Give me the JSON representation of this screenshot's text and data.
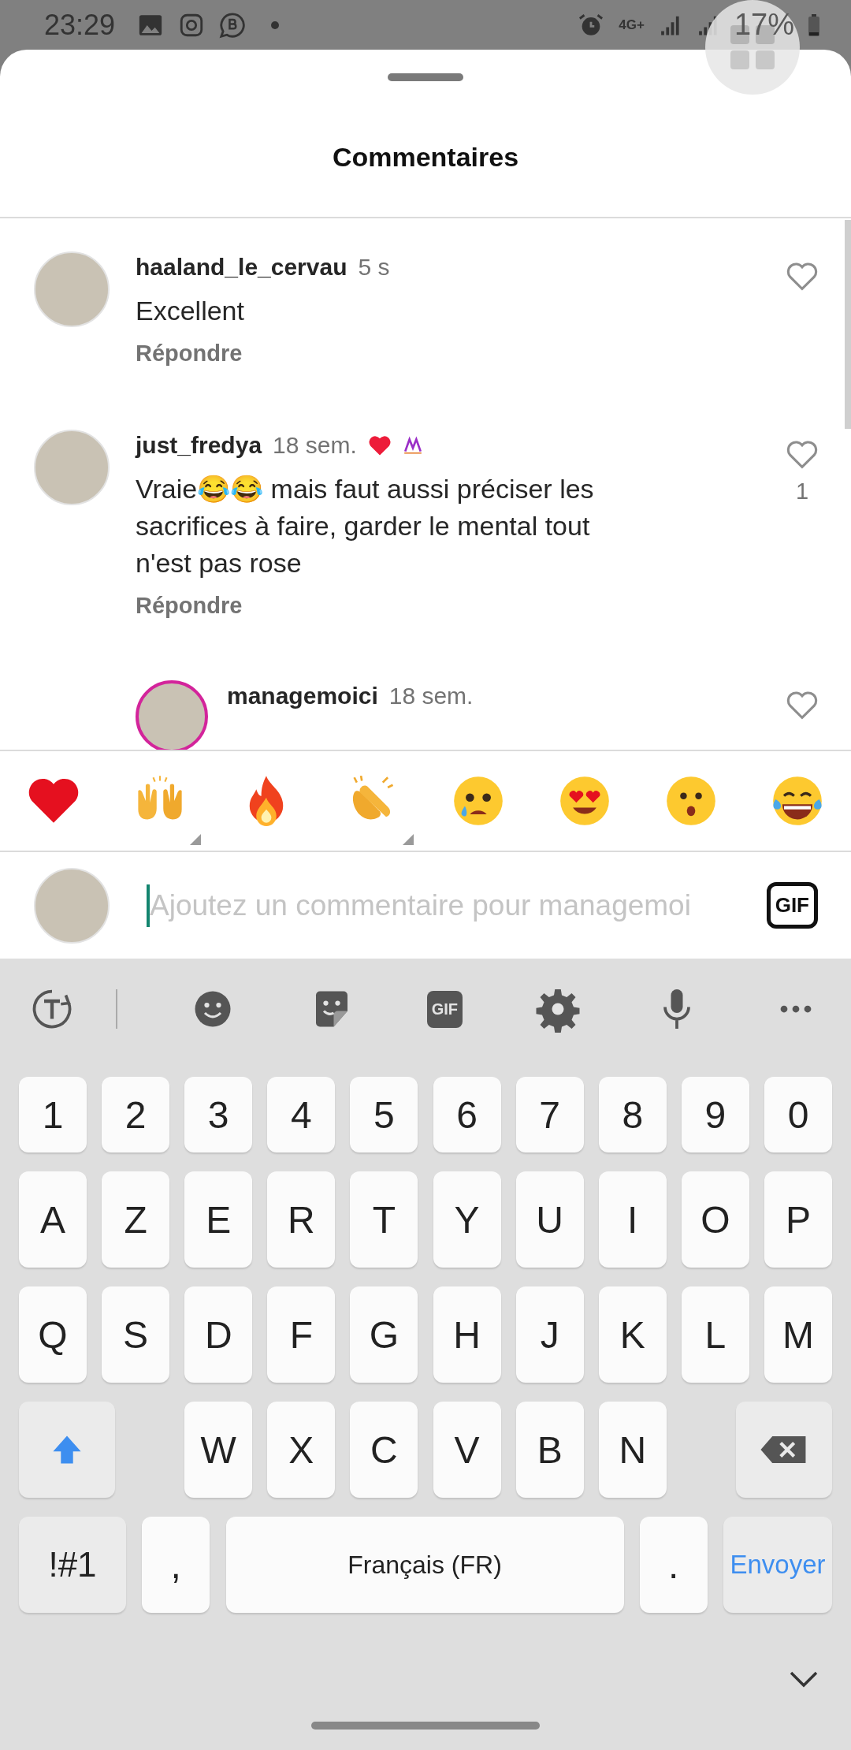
{
  "status_bar": {
    "time": "23:29",
    "network": "4G+",
    "battery": "17%"
  },
  "sheet": {
    "title": "Commentaires"
  },
  "comments": [
    {
      "username": "haaland_le_cervau",
      "time": "5 s",
      "text": "Excellent",
      "reply_label": "Répondre",
      "liked": false,
      "creator_liked": false
    },
    {
      "username": "just_fredya",
      "time": "18 sem.",
      "text": "Vraie😂😂 mais faut aussi préciser les sacrifices à faire, garder le mental tout n'est pas rose",
      "reply_label": "Répondre",
      "liked": false,
      "creator_liked": true,
      "likes": "1",
      "replies": [
        {
          "username": "managemoici",
          "time": "18 sem.",
          "liked": false,
          "story_ring": true
        }
      ]
    }
  ],
  "reactions": [
    {
      "kind": "heart",
      "variants": false
    },
    {
      "kind": "raised-hands",
      "variants": true
    },
    {
      "kind": "fire",
      "variants": false
    },
    {
      "kind": "clap",
      "variants": true
    },
    {
      "kind": "crying",
      "variants": false
    },
    {
      "kind": "heart-eyes",
      "variants": false
    },
    {
      "kind": "surprised",
      "variants": false
    },
    {
      "kind": "laughing",
      "variants": false
    }
  ],
  "composer": {
    "placeholder": "Ajoutez un commentaire pour managemoi",
    "gif_label": "GIF"
  },
  "keyboard": {
    "toolbar_gif": "GIF",
    "rows": [
      [
        {
          "kind": "char",
          "label": "1"
        },
        {
          "kind": "char",
          "label": "2"
        },
        {
          "kind": "char",
          "label": "3"
        },
        {
          "kind": "char",
          "label": "4"
        },
        {
          "kind": "char",
          "label": "5"
        },
        {
          "kind": "char",
          "label": "6"
        },
        {
          "kind": "char",
          "label": "7"
        },
        {
          "kind": "char",
          "label": "8"
        },
        {
          "kind": "char",
          "label": "9"
        },
        {
          "kind": "char",
          "label": "0"
        }
      ],
      [
        {
          "kind": "char",
          "label": "A"
        },
        {
          "kind": "char",
          "label": "Z"
        },
        {
          "kind": "char",
          "label": "E"
        },
        {
          "kind": "char",
          "label": "R"
        },
        {
          "kind": "char",
          "label": "T"
        },
        {
          "kind": "char",
          "label": "Y"
        },
        {
          "kind": "char",
          "label": "U"
        },
        {
          "kind": "char",
          "label": "I"
        },
        {
          "kind": "char",
          "label": "O"
        },
        {
          "kind": "char",
          "label": "P"
        }
      ],
      [
        {
          "kind": "char",
          "label": "Q"
        },
        {
          "kind": "char",
          "label": "S"
        },
        {
          "kind": "char",
          "label": "D"
        },
        {
          "kind": "char",
          "label": "F"
        },
        {
          "kind": "char",
          "label": "G"
        },
        {
          "kind": "char",
          "label": "H"
        },
        {
          "kind": "char",
          "label": "J"
        },
        {
          "kind": "char",
          "label": "K"
        },
        {
          "kind": "char",
          "label": "L"
        },
        {
          "kind": "char",
          "label": "M"
        }
      ],
      [
        {
          "kind": "shift",
          "on": true
        },
        "",
        {
          "kind": "char",
          "label": "W"
        },
        {
          "kind": "char",
          "label": "X"
        },
        {
          "kind": "char",
          "label": "C"
        },
        {
          "kind": "char",
          "label": "V"
        },
        {
          "kind": "char",
          "label": "B"
        },
        {
          "kind": "char",
          "label": "N"
        },
        "",
        {
          "kind": "backspace"
        }
      ]
    ],
    "bottom_row": [
      {
        "kind": "symbols",
        "label": "!#1"
      },
      {
        "kind": "char",
        "label": ","
      },
      {
        "kind": "space",
        "label": "Français (FR)"
      },
      {
        "kind": "char",
        "label": "."
      },
      {
        "kind": "send",
        "label": "Envoyer"
      }
    ]
  }
}
